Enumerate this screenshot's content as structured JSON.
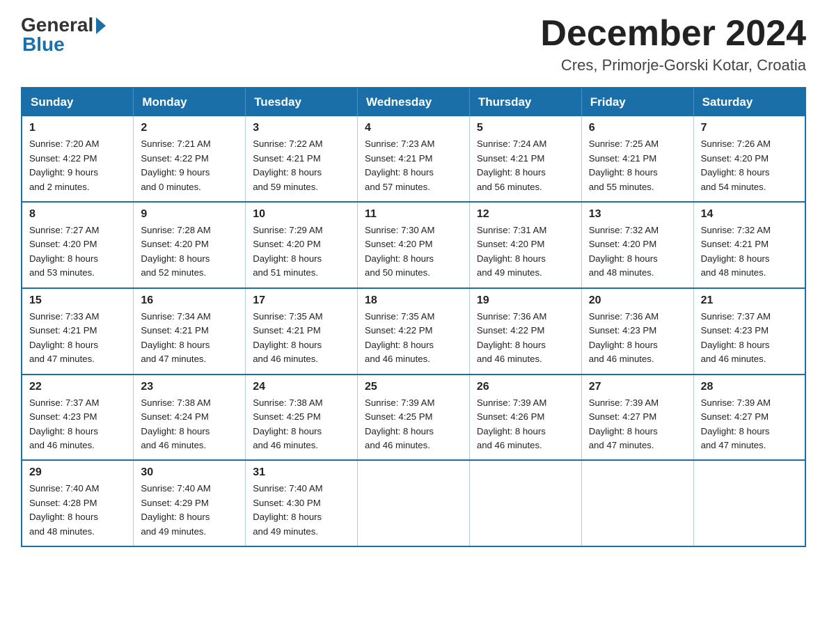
{
  "logo": {
    "general": "General",
    "blue": "Blue"
  },
  "title": {
    "month_year": "December 2024",
    "location": "Cres, Primorje-Gorski Kotar, Croatia"
  },
  "headers": [
    "Sunday",
    "Monday",
    "Tuesday",
    "Wednesday",
    "Thursday",
    "Friday",
    "Saturday"
  ],
  "weeks": [
    [
      {
        "day": "1",
        "sunrise": "7:20 AM",
        "sunset": "4:22 PM",
        "daylight": "9 hours and 2 minutes."
      },
      {
        "day": "2",
        "sunrise": "7:21 AM",
        "sunset": "4:22 PM",
        "daylight": "9 hours and 0 minutes."
      },
      {
        "day": "3",
        "sunrise": "7:22 AM",
        "sunset": "4:21 PM",
        "daylight": "8 hours and 59 minutes."
      },
      {
        "day": "4",
        "sunrise": "7:23 AM",
        "sunset": "4:21 PM",
        "daylight": "8 hours and 57 minutes."
      },
      {
        "day": "5",
        "sunrise": "7:24 AM",
        "sunset": "4:21 PM",
        "daylight": "8 hours and 56 minutes."
      },
      {
        "day": "6",
        "sunrise": "7:25 AM",
        "sunset": "4:21 PM",
        "daylight": "8 hours and 55 minutes."
      },
      {
        "day": "7",
        "sunrise": "7:26 AM",
        "sunset": "4:20 PM",
        "daylight": "8 hours and 54 minutes."
      }
    ],
    [
      {
        "day": "8",
        "sunrise": "7:27 AM",
        "sunset": "4:20 PM",
        "daylight": "8 hours and 53 minutes."
      },
      {
        "day": "9",
        "sunrise": "7:28 AM",
        "sunset": "4:20 PM",
        "daylight": "8 hours and 52 minutes."
      },
      {
        "day": "10",
        "sunrise": "7:29 AM",
        "sunset": "4:20 PM",
        "daylight": "8 hours and 51 minutes."
      },
      {
        "day": "11",
        "sunrise": "7:30 AM",
        "sunset": "4:20 PM",
        "daylight": "8 hours and 50 minutes."
      },
      {
        "day": "12",
        "sunrise": "7:31 AM",
        "sunset": "4:20 PM",
        "daylight": "8 hours and 49 minutes."
      },
      {
        "day": "13",
        "sunrise": "7:32 AM",
        "sunset": "4:20 PM",
        "daylight": "8 hours and 48 minutes."
      },
      {
        "day": "14",
        "sunrise": "7:32 AM",
        "sunset": "4:21 PM",
        "daylight": "8 hours and 48 minutes."
      }
    ],
    [
      {
        "day": "15",
        "sunrise": "7:33 AM",
        "sunset": "4:21 PM",
        "daylight": "8 hours and 47 minutes."
      },
      {
        "day": "16",
        "sunrise": "7:34 AM",
        "sunset": "4:21 PM",
        "daylight": "8 hours and 47 minutes."
      },
      {
        "day": "17",
        "sunrise": "7:35 AM",
        "sunset": "4:21 PM",
        "daylight": "8 hours and 46 minutes."
      },
      {
        "day": "18",
        "sunrise": "7:35 AM",
        "sunset": "4:22 PM",
        "daylight": "8 hours and 46 minutes."
      },
      {
        "day": "19",
        "sunrise": "7:36 AM",
        "sunset": "4:22 PM",
        "daylight": "8 hours and 46 minutes."
      },
      {
        "day": "20",
        "sunrise": "7:36 AM",
        "sunset": "4:23 PM",
        "daylight": "8 hours and 46 minutes."
      },
      {
        "day": "21",
        "sunrise": "7:37 AM",
        "sunset": "4:23 PM",
        "daylight": "8 hours and 46 minutes."
      }
    ],
    [
      {
        "day": "22",
        "sunrise": "7:37 AM",
        "sunset": "4:23 PM",
        "daylight": "8 hours and 46 minutes."
      },
      {
        "day": "23",
        "sunrise": "7:38 AM",
        "sunset": "4:24 PM",
        "daylight": "8 hours and 46 minutes."
      },
      {
        "day": "24",
        "sunrise": "7:38 AM",
        "sunset": "4:25 PM",
        "daylight": "8 hours and 46 minutes."
      },
      {
        "day": "25",
        "sunrise": "7:39 AM",
        "sunset": "4:25 PM",
        "daylight": "8 hours and 46 minutes."
      },
      {
        "day": "26",
        "sunrise": "7:39 AM",
        "sunset": "4:26 PM",
        "daylight": "8 hours and 46 minutes."
      },
      {
        "day": "27",
        "sunrise": "7:39 AM",
        "sunset": "4:27 PM",
        "daylight": "8 hours and 47 minutes."
      },
      {
        "day": "28",
        "sunrise": "7:39 AM",
        "sunset": "4:27 PM",
        "daylight": "8 hours and 47 minutes."
      }
    ],
    [
      {
        "day": "29",
        "sunrise": "7:40 AM",
        "sunset": "4:28 PM",
        "daylight": "8 hours and 48 minutes."
      },
      {
        "day": "30",
        "sunrise": "7:40 AM",
        "sunset": "4:29 PM",
        "daylight": "8 hours and 49 minutes."
      },
      {
        "day": "31",
        "sunrise": "7:40 AM",
        "sunset": "4:30 PM",
        "daylight": "8 hours and 49 minutes."
      },
      null,
      null,
      null,
      null
    ]
  ],
  "labels": {
    "sunrise": "Sunrise:",
    "sunset": "Sunset:",
    "daylight": "Daylight:"
  }
}
